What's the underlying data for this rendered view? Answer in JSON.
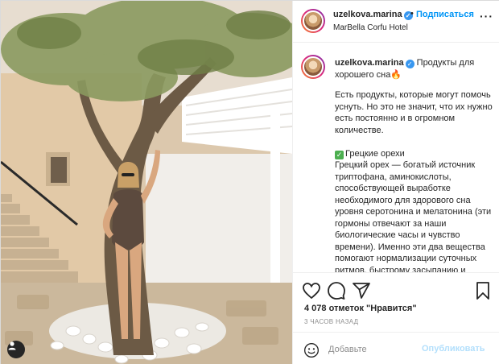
{
  "post": {
    "username": "uzelkova.marina",
    "follow_label": "Подписаться",
    "dot": "•",
    "location": "MarBella Corfu Hotel",
    "more_icon": "ellipsis-icon"
  },
  "caption": {
    "username": "uzelkova.marina",
    "headline": "Продукты для хорошего сна",
    "headline_emoji": "🔥",
    "intro": "Есть продукты, которые могут помочь уснуть. Но это не значит, что их нужно есть постоянно и в огромном количестве.",
    "section_title": "Грецкие орехи",
    "section_body": "Грецкий орех — богатый источник триптофана, аминокислоты, способствующей выработке необходимого для здорового сна уровня серотонина и мелатонина (эти гормоны отвечают за наши биологические часы и чувство времени). Именно эти два вещества помогают нормализации суточных ритмов, быстрому засыпанию и крепкому сну."
  },
  "actions": {
    "icons": [
      "heart-icon",
      "comment-icon",
      "share-icon",
      "bookmark-icon"
    ],
    "likes": "4 078 отметок \"Нравится\"",
    "time": "3 ЧАСОВ НАЗАД"
  },
  "comment": {
    "placeholder": "Добавьте",
    "publish_label": "Опубликовать"
  },
  "colors": {
    "accent": "#0095f6",
    "verified": "#3897f0",
    "text": "#262626",
    "muted": "#8e8e8e"
  }
}
